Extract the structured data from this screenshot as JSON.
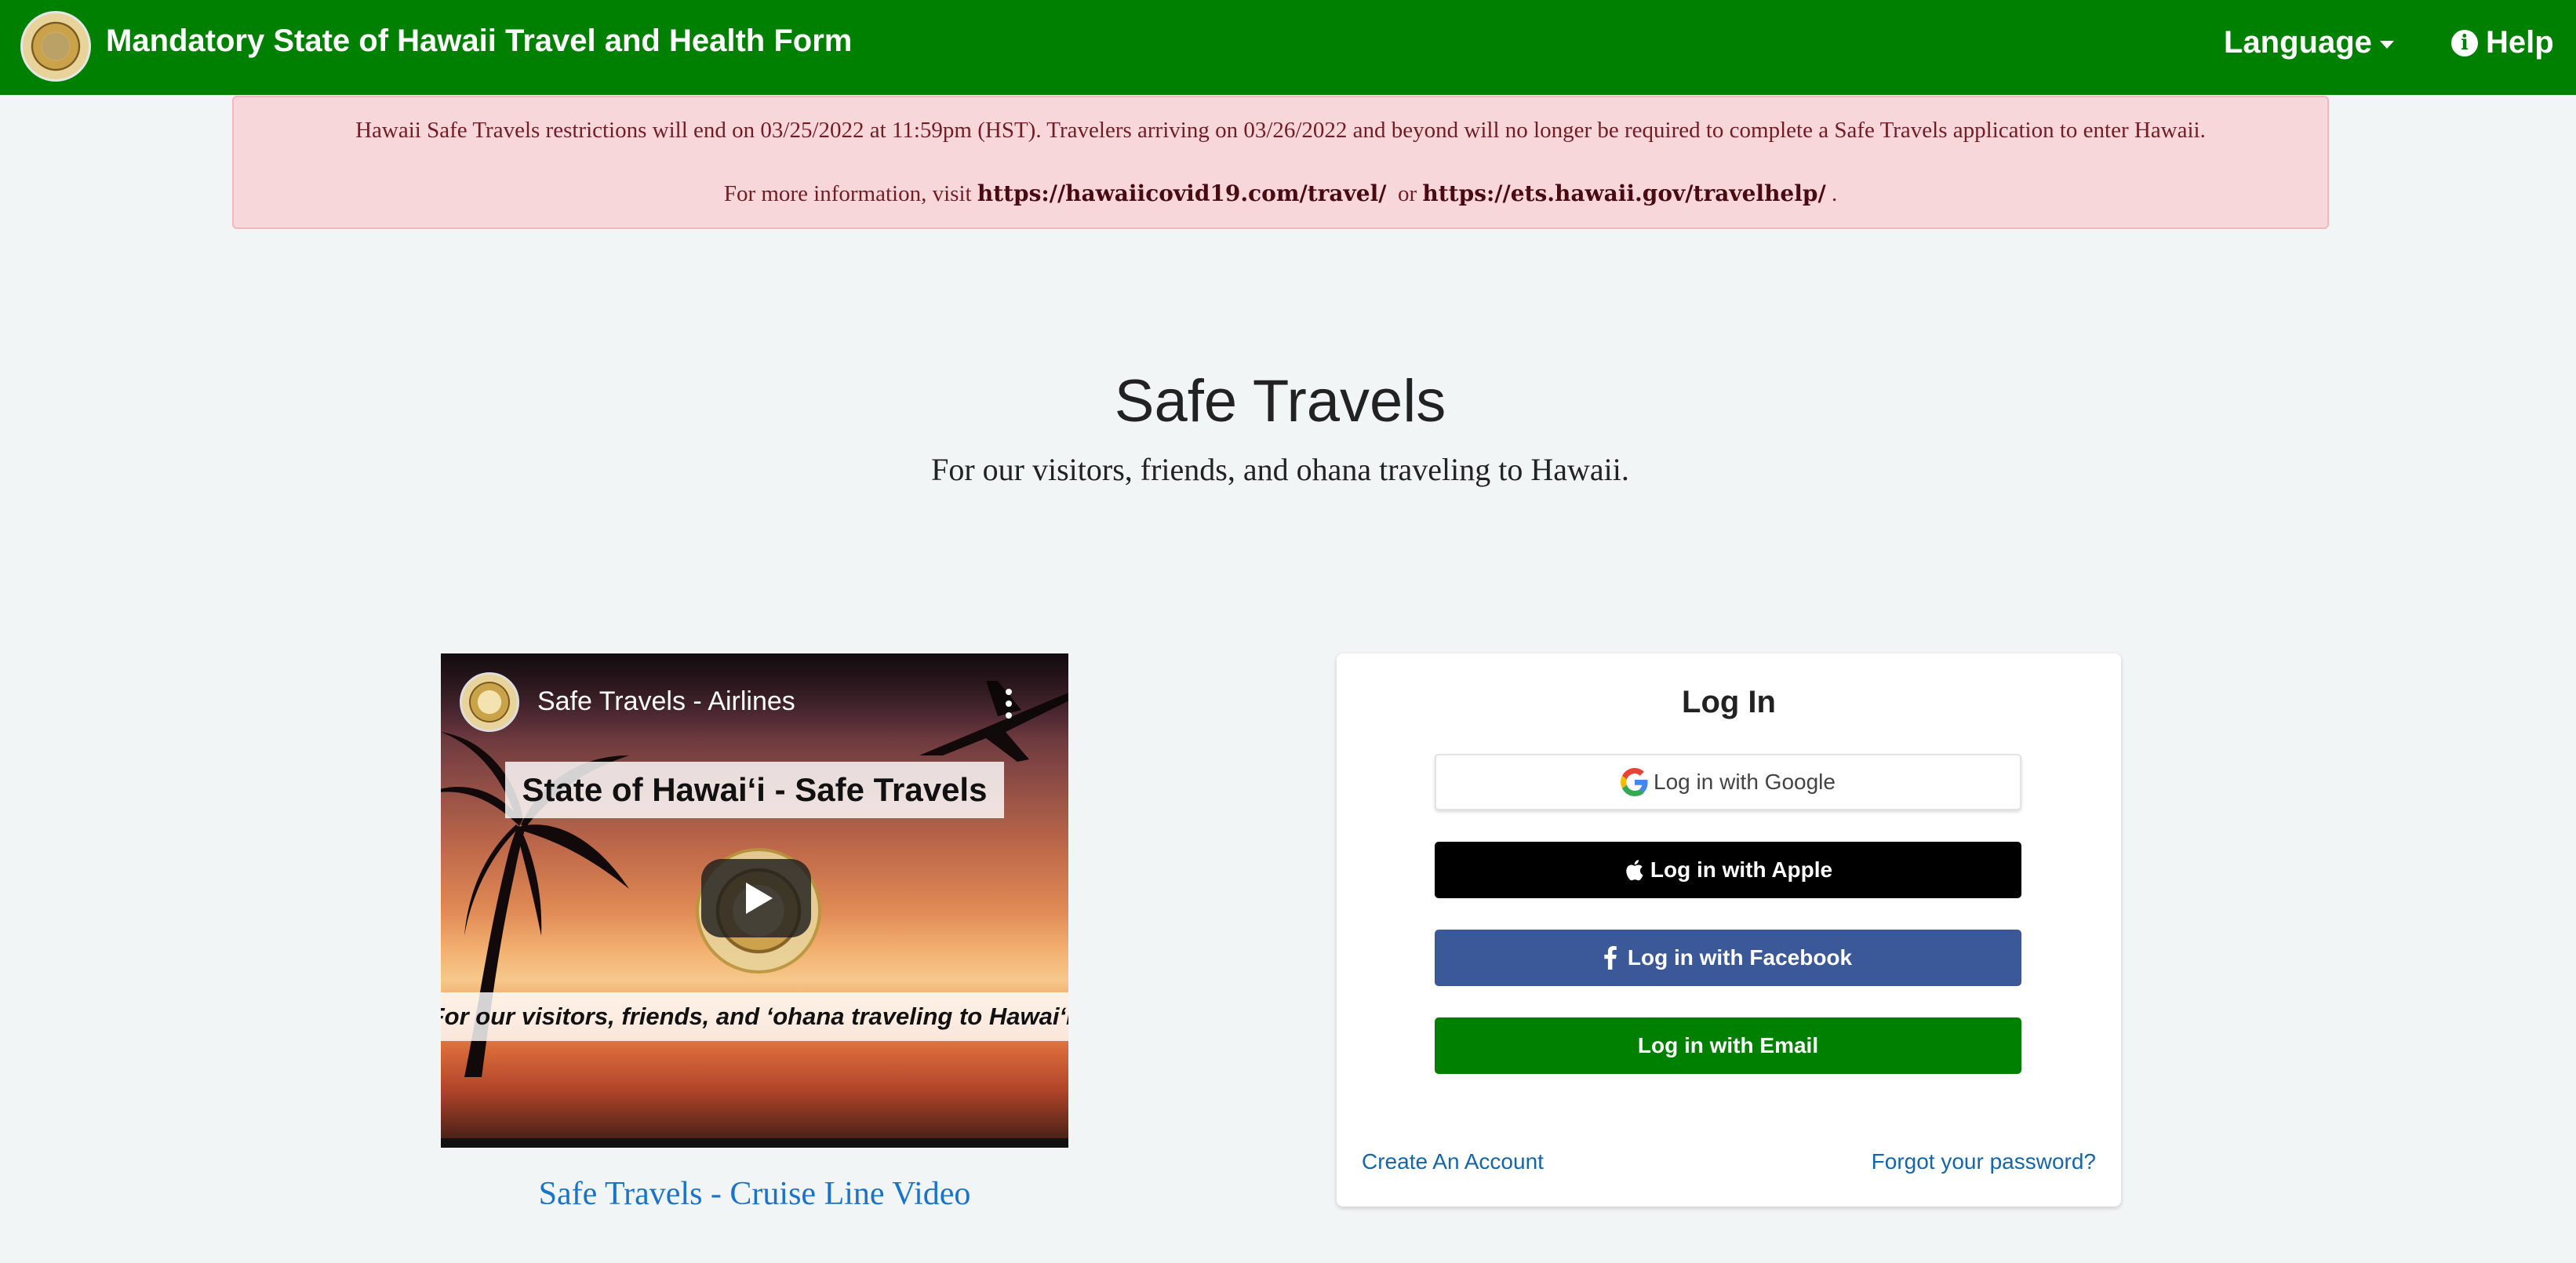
{
  "navbar": {
    "brand": "Mandatory State of Hawaii Travel and Health Form",
    "language_label": "Language",
    "help_label": "Help",
    "color": "#008000"
  },
  "alert": {
    "line1": "Hawaii Safe Travels restrictions will end on 03/25/2022 at 11:59pm (HST). Travelers arriving on 03/26/2022 and beyond will no longer be required to complete a Safe Travels application to enter Hawaii.",
    "line2_prefix": "For more information, visit",
    "link1": "https://hawaiicovid19.com/travel/",
    "connector": "or",
    "link2": "https://ets.hawaii.gov/travelhelp/",
    "suffix": "."
  },
  "hero": {
    "title": "Safe Travels",
    "subtitle": "For our visitors, friends, and ohana traveling to Hawaii."
  },
  "video": {
    "title": "Safe Travels - Airlines",
    "banner": "State of Hawaiʻi - Safe Travels",
    "strip": "For our visitors, friends, and ʻohana traveling to Hawaiʻi.",
    "link_label": "Safe Travels - Cruise Line Video"
  },
  "login": {
    "title": "Log In",
    "google_label": "Log in with Google",
    "apple_label": "Log in with Apple",
    "facebook_label": "Log in with Facebook",
    "email_label": "Log in with Email",
    "create_account": "Create An Account",
    "forgot_password": "Forgot your password?",
    "colors": {
      "apple": "#000000",
      "facebook": "#3b5998",
      "email": "#008000"
    }
  }
}
